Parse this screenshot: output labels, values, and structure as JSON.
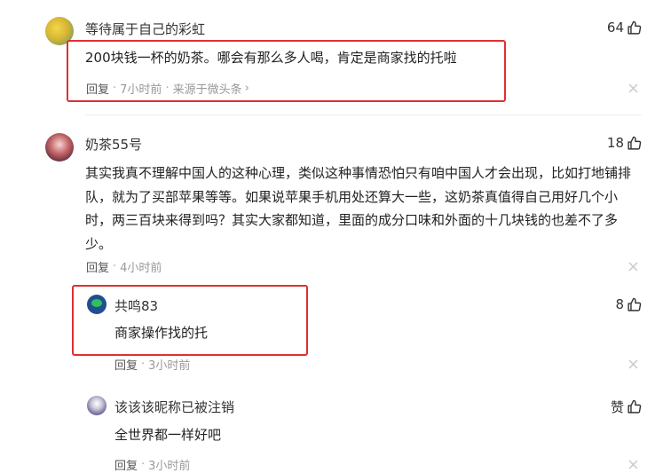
{
  "comments": [
    {
      "username": "等待属于自己的彩虹",
      "likes": "64",
      "text": "200块钱一杯的奶茶。哪会有那么多人喝，肯定是商家找的托啦",
      "reply_label": "回复",
      "time": "7小时前",
      "source": "来源于微头条",
      "source_chevron": "›",
      "separator": "·"
    },
    {
      "username": "奶茶55号",
      "likes": "18",
      "text": "其实我真不理解中国人的这种心理，类似这种事情恐怕只有咱中国人才会出现，比如打地铺排队，就为了买部苹果等等。如果说苹果手机用处还算大一些，这奶茶真值得自己用好几个小时，两三百块来得到吗？其实大家都知道，里面的成分口味和外面的十几块钱的也差不了多少。",
      "reply_label": "回复",
      "time": "4小时前",
      "separator": "·"
    }
  ],
  "replies": [
    {
      "username": "共鸣83",
      "likes": "8",
      "text": "商家操作找的托",
      "reply_label": "回复",
      "time": "3小时前",
      "separator": "·"
    },
    {
      "username": "该该该昵称已被注销",
      "likes": "赞",
      "text": "全世界都一样好吧",
      "reply_label": "回复",
      "time": "3小时前",
      "separator": "·"
    }
  ],
  "colors": {
    "highlight_border": "#e03030",
    "meta_text": "#999999",
    "body_text": "#222222"
  },
  "icons": [
    "thumbs-up-icon",
    "close-icon",
    "chevron-right-icon"
  ]
}
